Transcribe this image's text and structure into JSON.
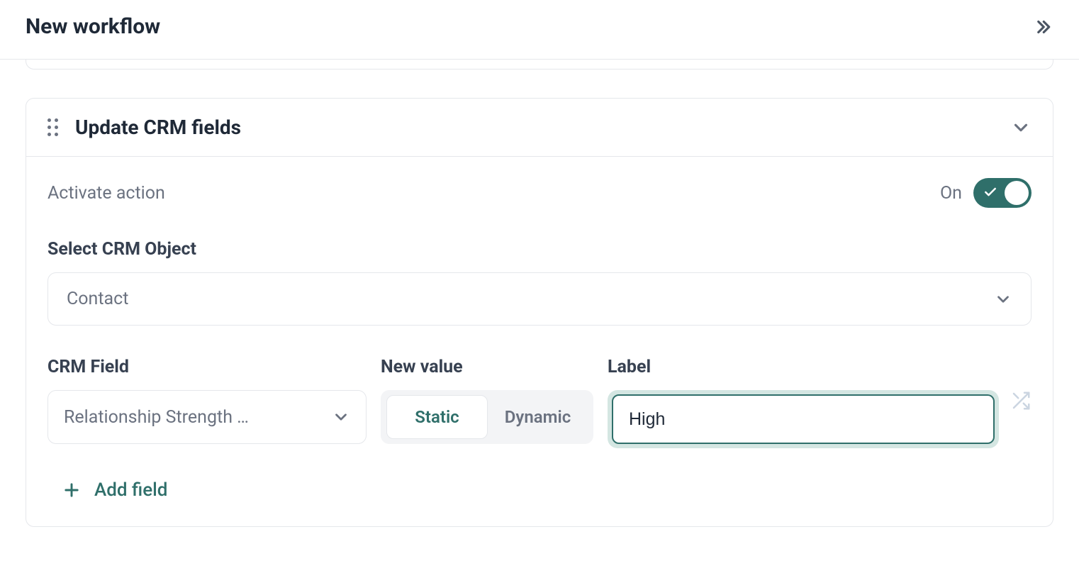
{
  "page": {
    "title": "New workflow"
  },
  "action": {
    "title": "Update CRM fields",
    "activate_label": "Activate action",
    "toggle_state": "On",
    "select_object_label": "Select CRM Object",
    "selected_object": "Contact",
    "columns": {
      "crm_field": "CRM Field",
      "new_value": "New value",
      "label": "Label"
    },
    "row": {
      "crm_field_value": "Relationship Strength …",
      "value_type_static": "Static",
      "value_type_dynamic": "Dynamic",
      "label_value": "High"
    },
    "add_field": "Add field"
  }
}
